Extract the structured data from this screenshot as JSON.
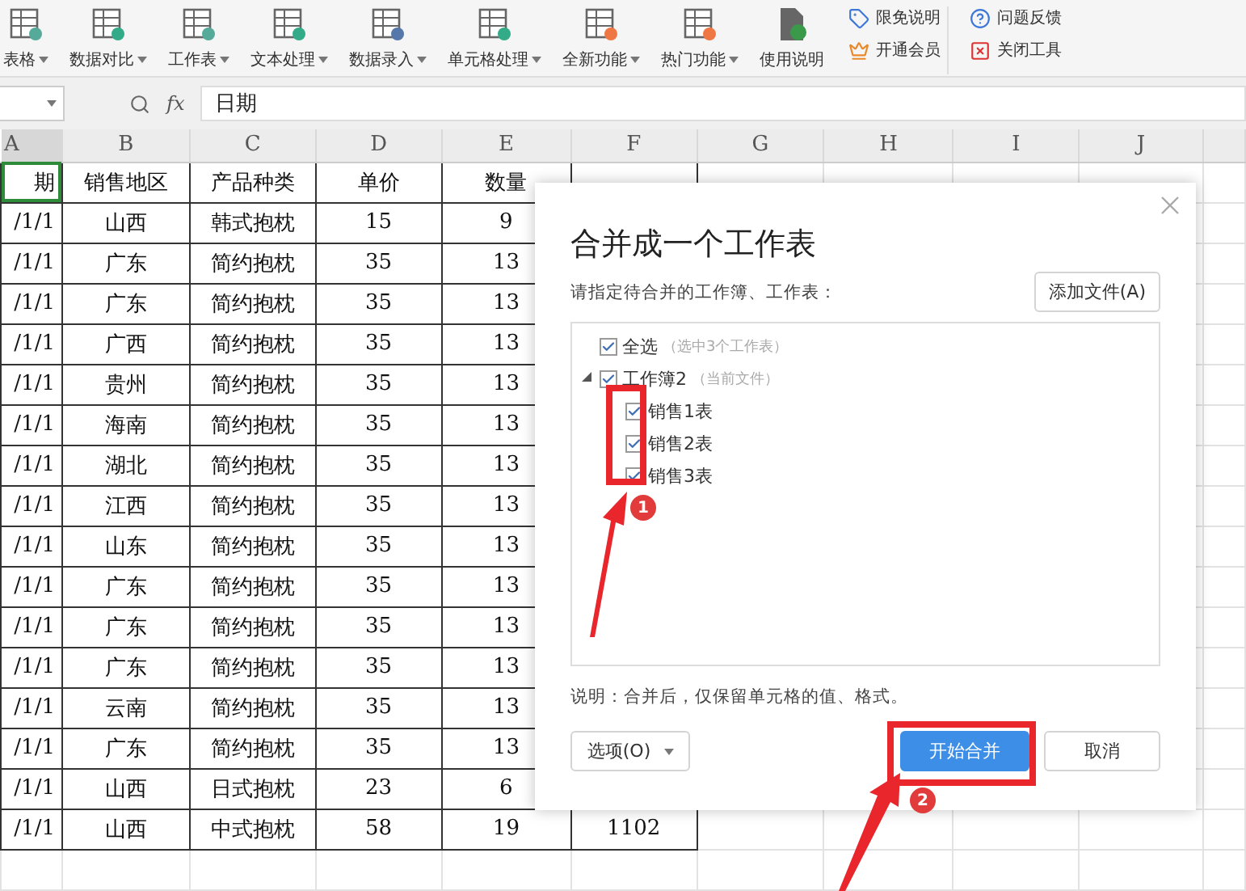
{
  "toolbar": {
    "items": [
      {
        "label": "表格",
        "dropdown": true
      },
      {
        "label": "数据对比",
        "dropdown": true
      },
      {
        "label": "工作表",
        "dropdown": true
      },
      {
        "label": "文本处理",
        "dropdown": true
      },
      {
        "label": "数据录入",
        "dropdown": true
      },
      {
        "label": "单元格处理",
        "dropdown": true
      },
      {
        "label": "全新功能",
        "dropdown": true
      },
      {
        "label": "热门功能",
        "dropdown": true
      },
      {
        "label": "使用说明",
        "dropdown": false
      }
    ],
    "small_items": [
      [
        {
          "label": "限免说明"
        },
        {
          "label": "开通会员"
        }
      ],
      [
        {
          "label": "问题反馈"
        },
        {
          "label": "关闭工具"
        }
      ]
    ]
  },
  "formula_bar": {
    "fx": "fx",
    "formula": "日期"
  },
  "column_headers": [
    {
      "label": "A",
      "selected": true
    },
    {
      "label": "B",
      "selected": false
    },
    {
      "label": "C",
      "selected": false
    },
    {
      "label": "D",
      "selected": false
    },
    {
      "label": "E",
      "selected": false
    },
    {
      "label": "F",
      "selected": false
    },
    {
      "label": "G",
      "selected": false
    },
    {
      "label": "H",
      "selected": false
    },
    {
      "label": "I",
      "selected": false
    },
    {
      "label": "J",
      "selected": false
    }
  ],
  "rows": [
    {
      "selected": true,
      "cells": [
        "期",
        "销售地区",
        "产品种类",
        "单价",
        "数量"
      ]
    },
    {
      "selected": false,
      "cells": [
        "/1/1",
        "山西",
        "韩式抱枕",
        "15",
        "9"
      ]
    },
    {
      "selected": false,
      "cells": [
        "/1/1",
        "广东",
        "简约抱枕",
        "35",
        "13"
      ]
    },
    {
      "selected": false,
      "cells": [
        "/1/1",
        "广东",
        "简约抱枕",
        "35",
        "13"
      ]
    },
    {
      "selected": false,
      "cells": [
        "/1/1",
        "广西",
        "简约抱枕",
        "35",
        "13"
      ]
    },
    {
      "selected": false,
      "cells": [
        "/1/1",
        "贵州",
        "简约抱枕",
        "35",
        "13"
      ]
    },
    {
      "selected": false,
      "cells": [
        "/1/1",
        "海南",
        "简约抱枕",
        "35",
        "13"
      ]
    },
    {
      "selected": false,
      "cells": [
        "/1/1",
        "湖北",
        "简约抱枕",
        "35",
        "13"
      ]
    },
    {
      "selected": false,
      "cells": [
        "/1/1",
        "江西",
        "简约抱枕",
        "35",
        "13"
      ]
    },
    {
      "selected": false,
      "cells": [
        "/1/1",
        "山东",
        "简约抱枕",
        "35",
        "13"
      ]
    },
    {
      "selected": false,
      "cells": [
        "/1/1",
        "广东",
        "简约抱枕",
        "35",
        "13"
      ]
    },
    {
      "selected": false,
      "cells": [
        "/1/1",
        "广东",
        "简约抱枕",
        "35",
        "13"
      ]
    },
    {
      "selected": false,
      "cells": [
        "/1/1",
        "广东",
        "简约抱枕",
        "35",
        "13"
      ]
    },
    {
      "selected": false,
      "cells": [
        "/1/1",
        "云南",
        "简约抱枕",
        "35",
        "13"
      ]
    },
    {
      "selected": false,
      "cells": [
        "/1/1",
        "广东",
        "简约抱枕",
        "35",
        "13"
      ]
    },
    {
      "selected": false,
      "cells": [
        "/1/1",
        "山西",
        "日式抱枕",
        "23",
        "6"
      ]
    },
    {
      "selected": false,
      "cells": [
        "/1/1",
        "山西",
        "中式抱枕",
        "58",
        "19",
        "1102"
      ]
    }
  ],
  "dialog": {
    "title": "合并成一个工作表",
    "prompt": "请指定待合并的工作簿、工作表：",
    "add_button": "添加文件(A)",
    "tree": [
      {
        "label": "全选",
        "hint": "（选中3个工作表）",
        "checked": true
      },
      {
        "label": "工作簿2",
        "hint": "（当前文件）",
        "checked": true,
        "expanded": true,
        "children": [
          {
            "label": "销售1表",
            "checked": true
          },
          {
            "label": "销售2表",
            "checked": true
          },
          {
            "label": "销售3表",
            "checked": true
          }
        ]
      }
    ],
    "note": "说明：合并后，仅保留单元格的值、格式。",
    "options_button": "选项(O)",
    "start_button": "开始合并",
    "cancel_button": "取消"
  },
  "annotations": [
    {
      "label": "1"
    },
    {
      "label": "2"
    }
  ]
}
